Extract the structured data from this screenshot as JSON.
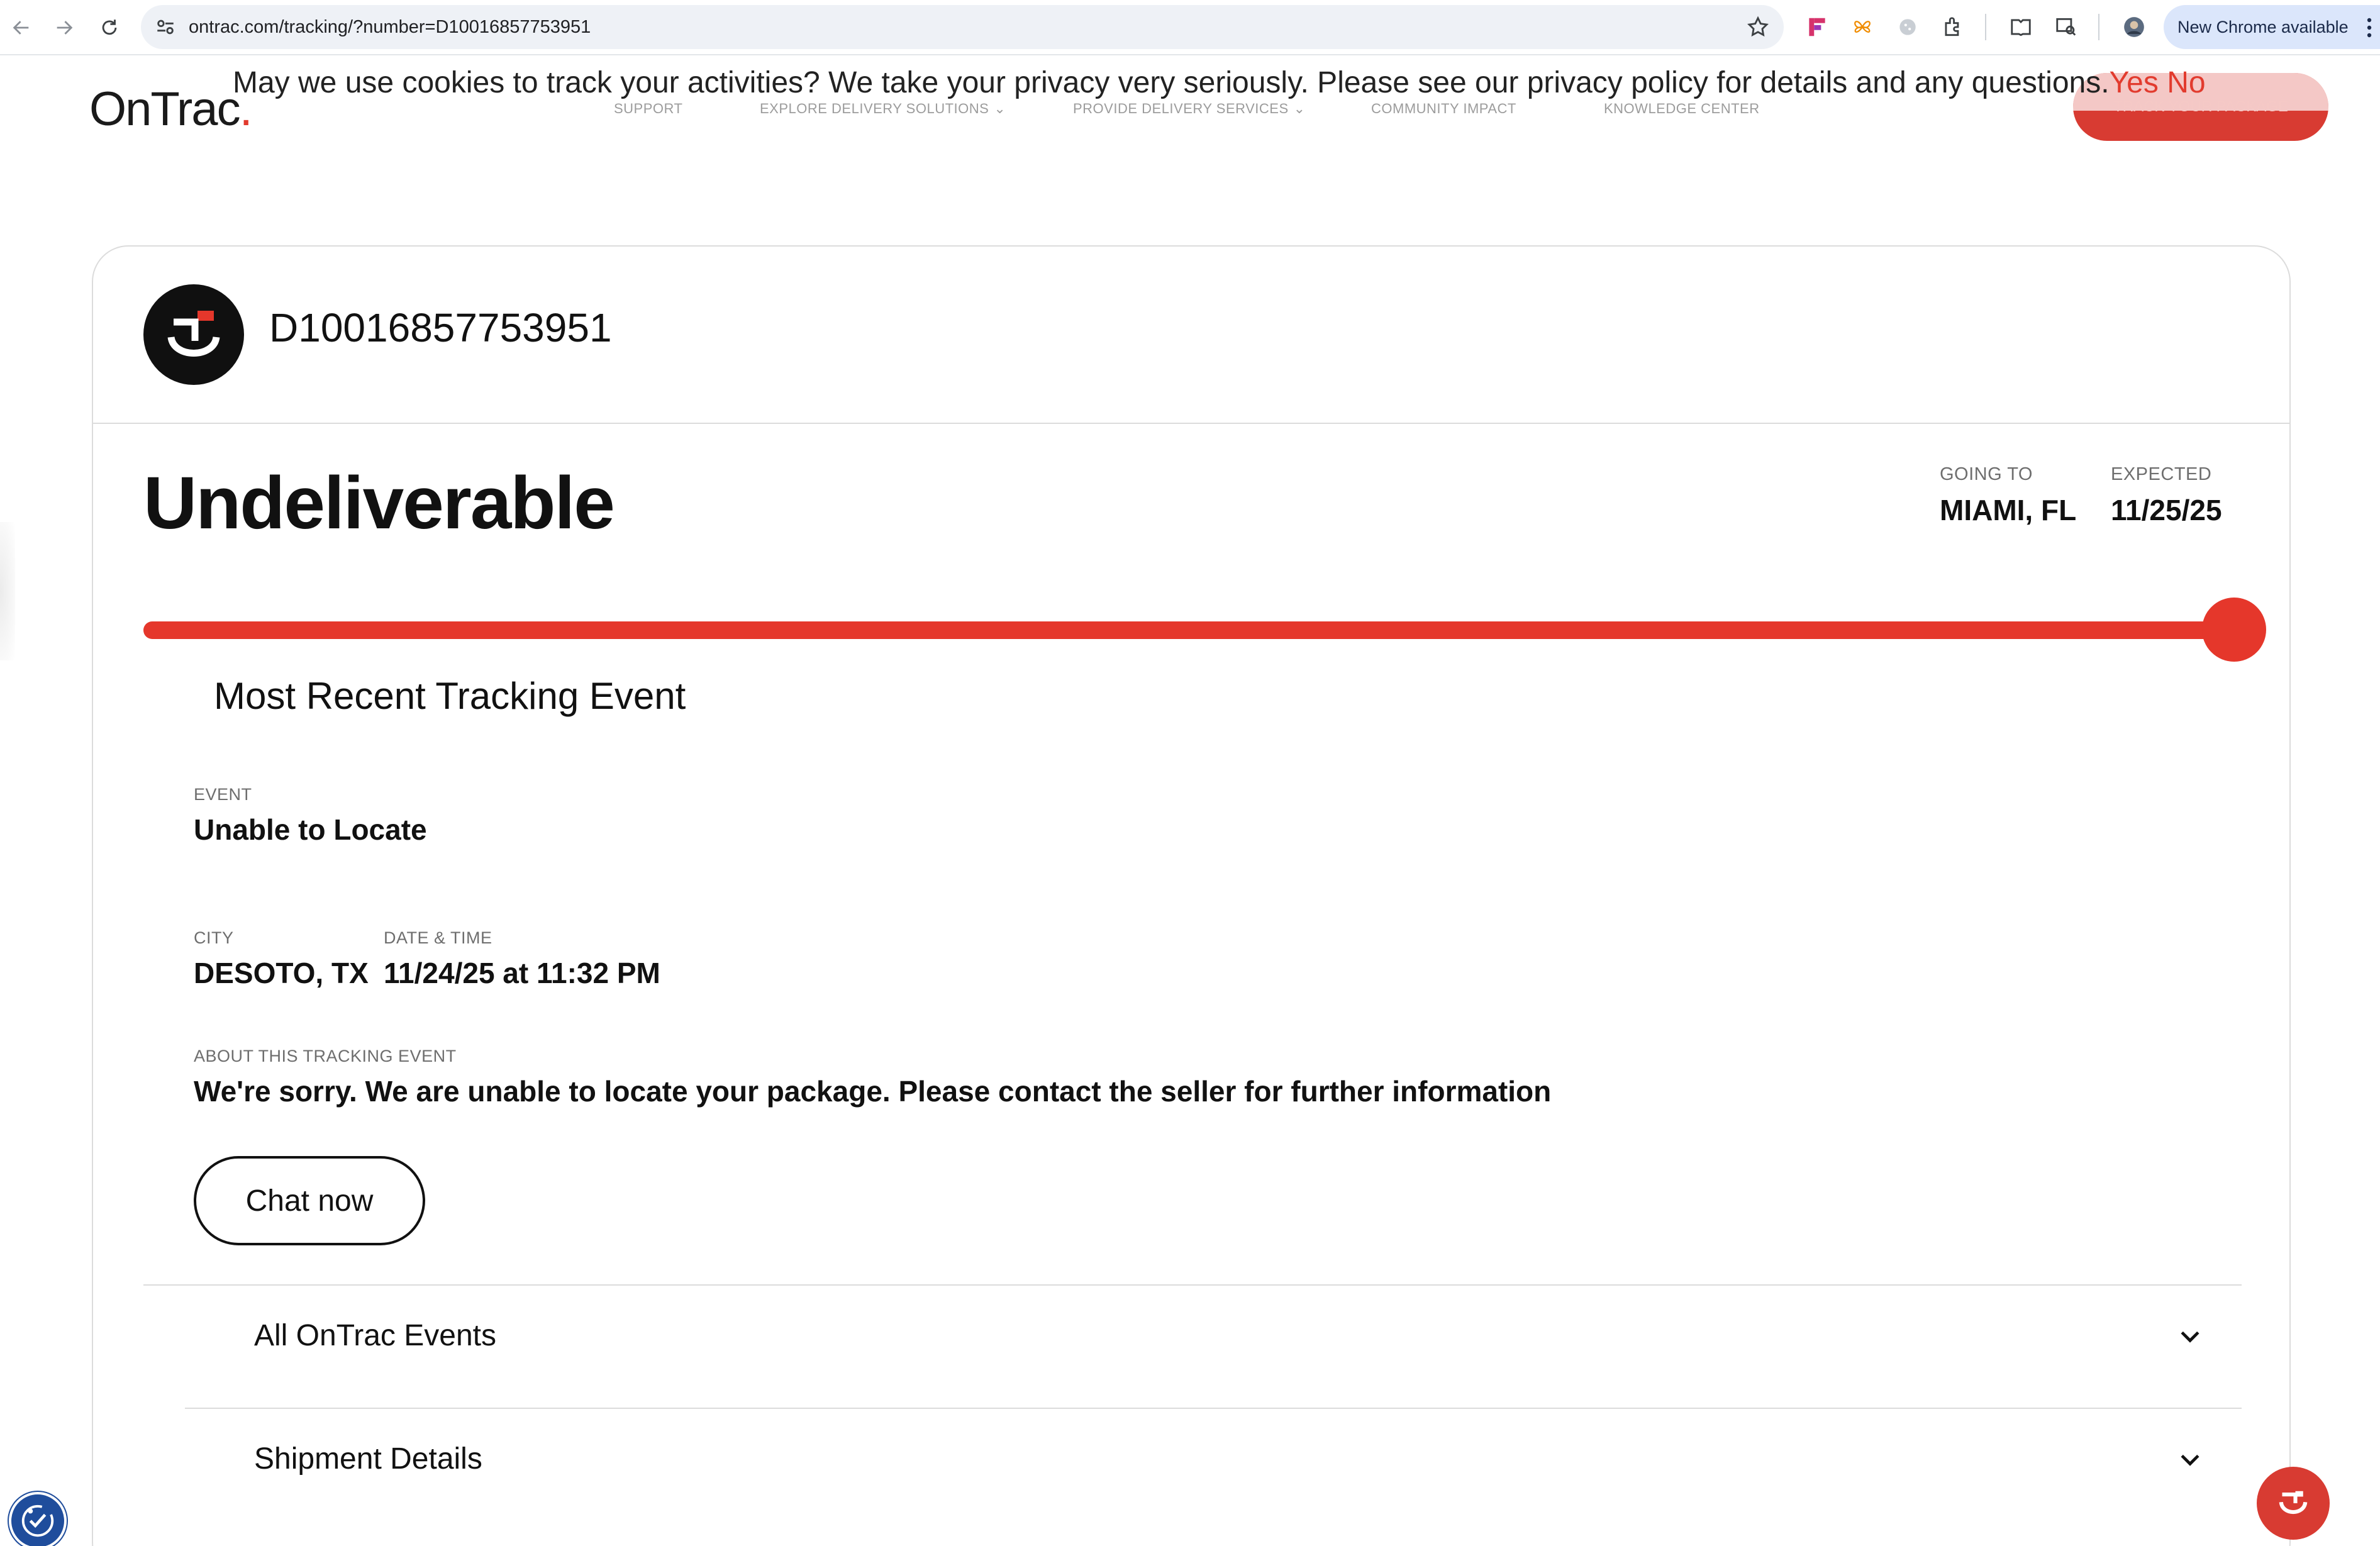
{
  "browser": {
    "url": "ontrac.com/tracking/?number=D10016857753951",
    "new_chrome_label": "New Chrome available",
    "icons": [
      "back-icon",
      "forward-icon",
      "reload-icon",
      "site-settings-icon",
      "bookmark-star-icon",
      "extension-icons",
      "profile-avatar",
      "kebab-menu-icon"
    ]
  },
  "cookie_banner": {
    "text": "May we use cookies to track your activities? We take your privacy very seriously. Please see our privacy policy for details and any questions.",
    "yes_label": "Yes",
    "no_label": "No"
  },
  "header": {
    "logo_text": "OnTrac",
    "logo_dot": ".",
    "nav": [
      {
        "label": "SUPPORT",
        "has_dropdown": false
      },
      {
        "label": "EXPLORE DELIVERY SOLUTIONS",
        "has_dropdown": true
      },
      {
        "label": "PROVIDE DELIVERY SERVICES",
        "has_dropdown": true
      },
      {
        "label": "COMMUNITY IMPACT",
        "has_dropdown": false
      },
      {
        "label": "KNOWLEDGE CENTER",
        "has_dropdown": false
      }
    ],
    "cta_label": "TRACK YOUR PACKAGE"
  },
  "tracking": {
    "number": "D10016857753951",
    "status": "Undeliverable",
    "going_to_label": "GOING TO",
    "going_to_value": "MIAMI, FL",
    "expected_label": "EXPECTED",
    "expected_value": "11/25/25",
    "progress_fraction": 1.0,
    "recent_title": "Most Recent Tracking Event",
    "event_label": "EVENT",
    "event_value": "Unable to Locate",
    "city_label": "CITY",
    "city_value": "DESOTO, TX",
    "datetime_label": "DATE & TIME",
    "datetime_value": "11/24/25 at 11:32 PM",
    "about_label": "ABOUT THIS TRACKING EVENT",
    "about_value": "We're sorry. We are unable to locate your package. Please contact the seller for further information",
    "chat_label": "Chat now",
    "accordions": [
      {
        "label": "All OnTrac Events"
      },
      {
        "label": "Shipment Details"
      }
    ]
  },
  "colors": {
    "brand_red": "#e5372b",
    "text_dark": "#111111",
    "muted": "#6e6e6e",
    "border": "#dcdcdc",
    "accessibility_blue": "#1f4d9c"
  }
}
